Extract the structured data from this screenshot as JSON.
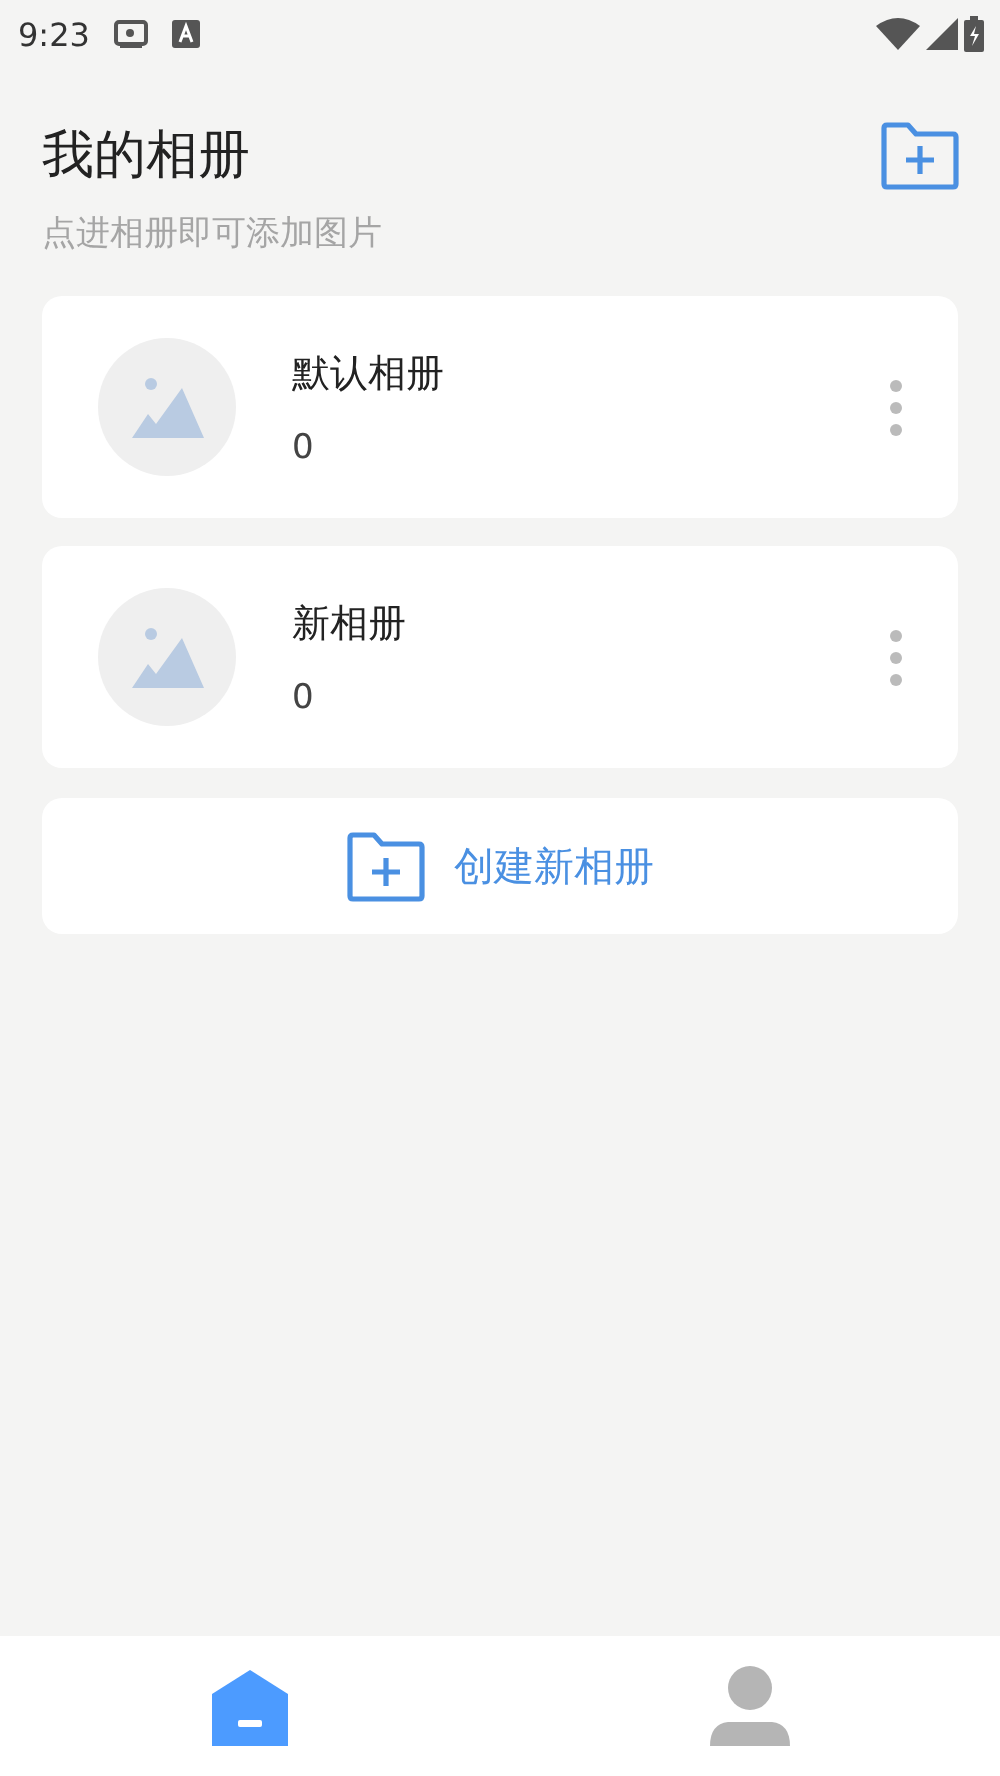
{
  "status_bar": {
    "time": "9:23"
  },
  "header": {
    "title": "我的相册",
    "subtitle": "点进相册即可添加图片"
  },
  "albums": [
    {
      "name": "默认相册",
      "count": "0"
    },
    {
      "name": "新相册",
      "count": "0"
    }
  ],
  "create_button": {
    "label": "创建新相册"
  },
  "bottom_nav": [
    {
      "kind": "home",
      "selected": true
    },
    {
      "kind": "profile",
      "selected": false
    }
  ]
}
